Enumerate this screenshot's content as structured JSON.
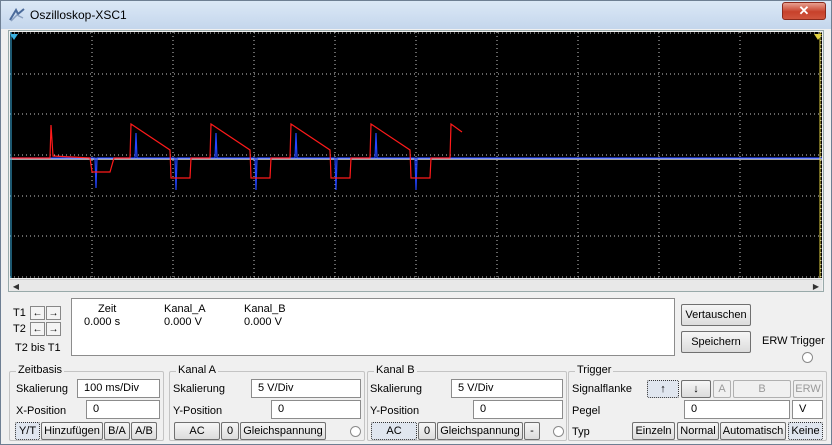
{
  "window": {
    "title": "Oszilloskop-XSC1",
    "close_glyph": "✕"
  },
  "cursor": {
    "t1_label": "T1",
    "t2_label": "T2",
    "t2_minus_t1_label": "T2 bis T1",
    "left_arrow": "←",
    "right_arrow": "→"
  },
  "readout": {
    "time_header": "Zeit",
    "channel_a_header": "Kanal_A",
    "channel_b_header": "Kanal_B",
    "time_value": "0.000 s",
    "channel_a_value": "0.000 V",
    "channel_b_value": "0.000 V"
  },
  "buttons": {
    "swap": "Vertauschen",
    "save": "Speichern"
  },
  "ext_trigger": {
    "label": "ERW Trigger"
  },
  "zeitbasis": {
    "title": "Zeitbasis",
    "scale_label": "Skalierung",
    "scale_value": "100 ms/Div",
    "xpos_label": "X-Position",
    "xpos_value": "0",
    "mode_yt": "Y/T",
    "mode_add": "Hinzufügen",
    "mode_ba": "B/A",
    "mode_ab": "A/B"
  },
  "kanal_a": {
    "title": "Kanal A",
    "scale_label": "Skalierung",
    "scale_value": "5  V/Div",
    "ypos_label": "Y-Position",
    "ypos_value": "0",
    "coupling_ac": "AC",
    "coupling_0": "0",
    "coupling_dc": "Gleichspannung"
  },
  "kanal_b": {
    "title": "Kanal B",
    "scale_label": "Skalierung",
    "scale_value": "5  V/Div",
    "ypos_label": "Y-Position",
    "ypos_value": "0",
    "coupling_ac": "AC",
    "coupling_0": "0",
    "coupling_dc": "Gleichspannung",
    "invert": "-"
  },
  "trigger": {
    "title": "Trigger",
    "edge_label": "Signalflanke",
    "edge_rising": "↑",
    "edge_falling": "↓",
    "source_a": "A",
    "source_b": "B",
    "source_ext": "ERW",
    "level_label": "Pegel",
    "level_value": "0",
    "level_unit": "V",
    "type_label": "Typ",
    "type_single": "Einzeln",
    "type_normal": "Normal",
    "type_auto": "Automatisch",
    "type_none": "Keine"
  },
  "colors": {
    "screen_bg": "#000000",
    "grid": "#c8c8c8",
    "channel_a": "#ff1a1a",
    "channel_b": "#2244ff",
    "ext": "#ffffff",
    "t1_marker": "#3ab0e0",
    "t2_marker": "#e0d040"
  },
  "icons": {
    "title": "oscilloscope-icon",
    "rising_edge": "rising-edge-icon",
    "falling_edge": "falling-edge-icon"
  }
}
